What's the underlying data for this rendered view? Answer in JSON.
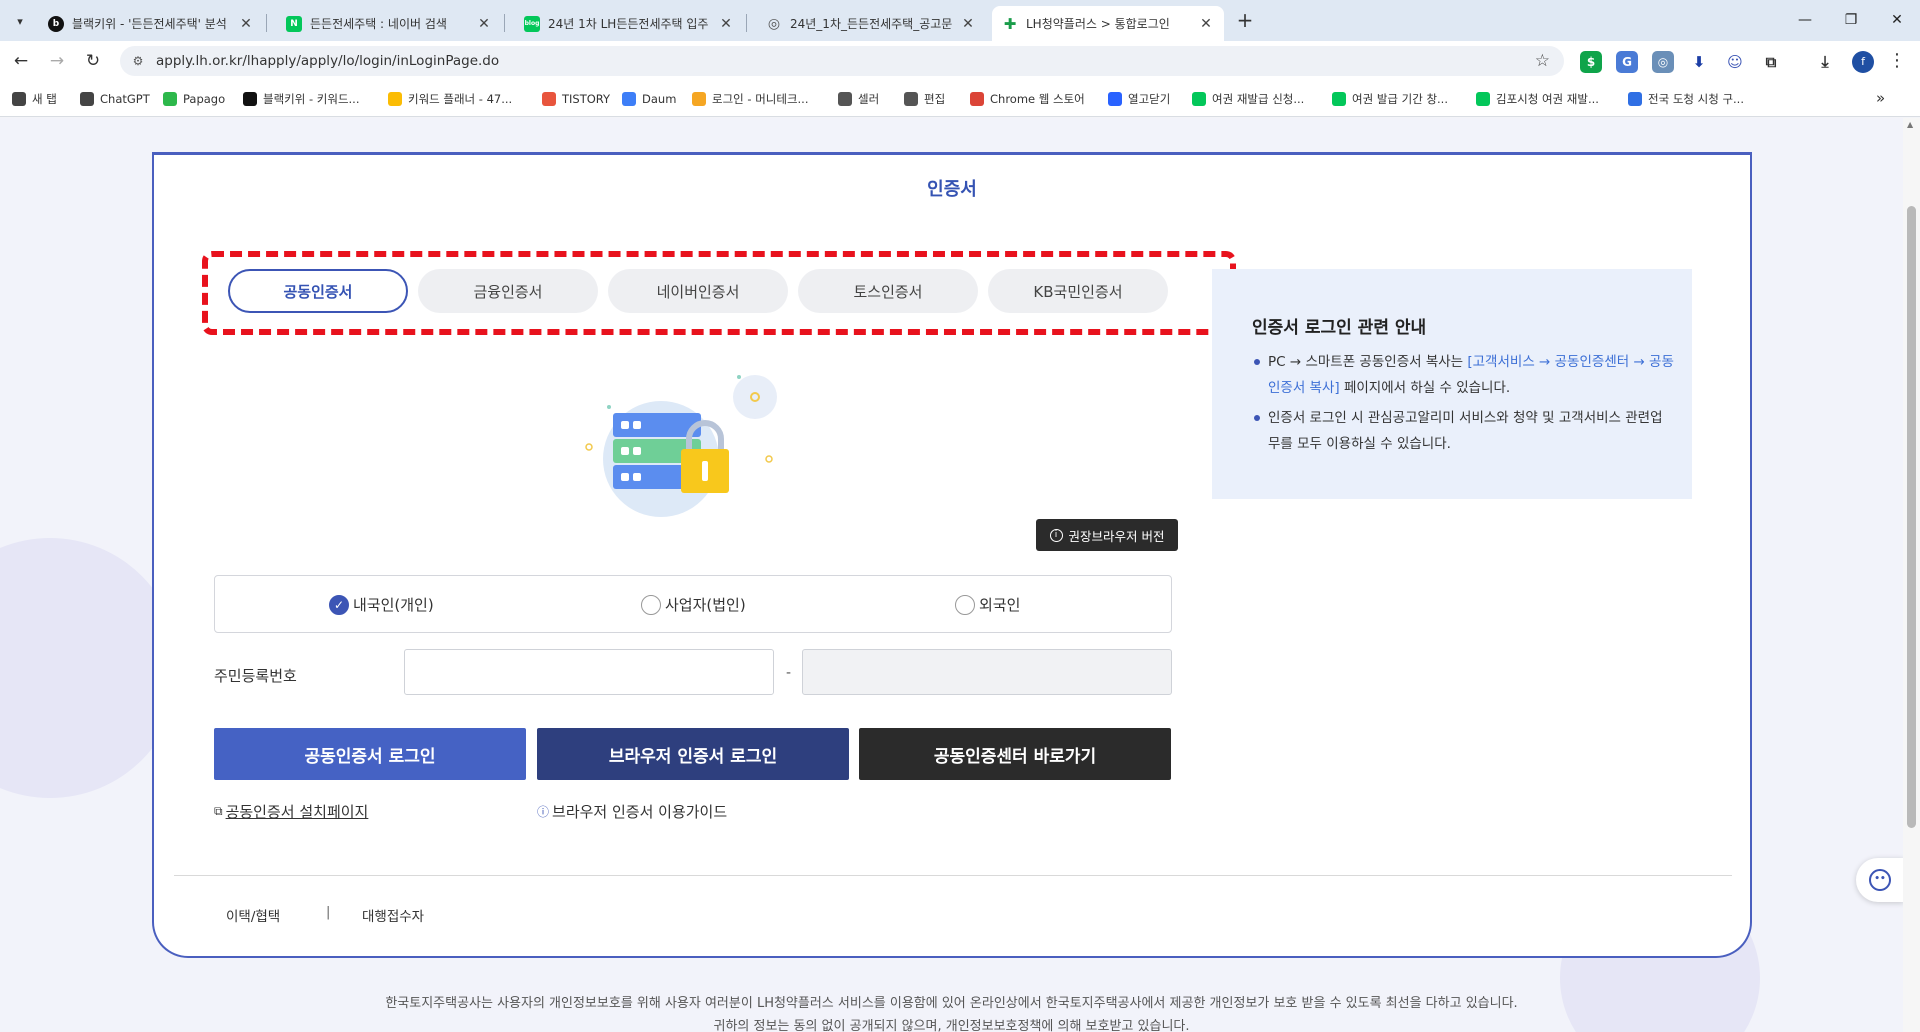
{
  "browser": {
    "tabs": [
      {
        "title": "블랙키위 - '든든전세주택' 분석",
        "fav": "b",
        "fav_color": "#111111"
      },
      {
        "title": "든든전세주택 : 네이버 검색",
        "fav": "N",
        "fav_color": "#03c75a"
      },
      {
        "title": "24년 1차 LH든든전세주택 입주",
        "fav": "blog",
        "fav_color": "#03c75a"
      },
      {
        "title": "24년_1차_든든전세주택_공고문",
        "fav": "◎",
        "fav_color": "#555555"
      },
      {
        "title": "LH청약플러스 > 통합로그인",
        "fav": "✚",
        "fav_color": "#1a9c4a"
      }
    ],
    "url": "apply.lh.or.kr/lhapply/apply/lo/login/inLoginPage.do",
    "bookmarks": [
      {
        "label": "새 탭",
        "icon": "globe-icon",
        "color": "#444444"
      },
      {
        "label": "ChatGPT",
        "icon": "chatgpt-icon",
        "color": "#444444"
      },
      {
        "label": "Papago",
        "icon": "papago-icon",
        "color": "#2db84b"
      },
      {
        "label": "블랙키위 - 키워드...",
        "icon": "blackkiwi-icon",
        "color": "#111111"
      },
      {
        "label": "키워드 플래너 - 47...",
        "icon": "google-ads-icon",
        "color": "#fbbc04"
      },
      {
        "label": "TISTORY",
        "icon": "tistory-icon",
        "color": "#e8553d"
      },
      {
        "label": "Daum",
        "icon": "daum-icon",
        "color": "#3d7ef7"
      },
      {
        "label": "로그인 - 머니테크...",
        "icon": "moneytech-icon",
        "color": "#f5a623"
      },
      {
        "label": "셀러",
        "icon": "folder-icon",
        "color": "#555555"
      },
      {
        "label": "편집",
        "icon": "folder-icon",
        "color": "#555555"
      },
      {
        "label": "Chrome 웹 스토어",
        "icon": "chrome-store-icon",
        "color": "#db4437"
      },
      {
        "label": "열고닫기",
        "icon": "toggle-icon",
        "color": "#2962ff"
      },
      {
        "label": "여권 재발급 신청...",
        "icon": "naver-blog-icon",
        "color": "#03c75a"
      },
      {
        "label": "여권 발급 기간 창...",
        "icon": "naver-blog-icon",
        "color": "#03c75a"
      },
      {
        "label": "김포시청 여권 재발...",
        "icon": "naver-blog-icon",
        "color": "#03c75a"
      },
      {
        "label": "전국 도청 시청 구...",
        "icon": "info-blog-icon",
        "color": "#2f6fe4"
      }
    ],
    "profile_initial": "f"
  },
  "page": {
    "title": "인증서",
    "cert_tabs": [
      "공동인증서",
      "금융인증서",
      "네이버인증서",
      "토스인증서",
      "KB국민인증서"
    ],
    "active_tab": 0,
    "browser_version_btn": "권장브라우저 버전",
    "user_types": [
      {
        "label": "내국인(개인)",
        "checked": true
      },
      {
        "label": "사업자(법인)",
        "checked": false
      },
      {
        "label": "외국인",
        "checked": false
      }
    ],
    "rrn_label": "주민등록번호",
    "rrn_dash": "-",
    "buttons": {
      "cert_login": "공동인증서 로그인",
      "browser_cert_login": "브라우저 인증서 로그인",
      "cert_center": "공동인증센터 바로가기"
    },
    "links": {
      "install": "공동인증서 설치페이지",
      "guide": "브라우저 인증서 이용가이드"
    },
    "footer_links": [
      "이택/협택",
      "대행접수자"
    ],
    "footer_sep": "|",
    "info": {
      "title": "인증서 로그인 관련 안내",
      "item1_pre": "PC → 스마트폰 공동인증서 복사는 ",
      "item1_hl": "[고객서비스 → 공동인증센터 → 공동인증서 복사]",
      "item1_post": " 페이지에서 하실 수 있습니다.",
      "item2": "인증서 로그인 시 관심공고알리미 서비스와 청약 및 고객서비스 관련업무를 모두 이용하실 수 있습니다."
    },
    "privacy_line1": "한국토지주택공사는 사용자의 개인정보보호를 위해 사용자 여러분이 LH청약플러스 서비스를 이용함에 있어 온라인상에서 한국토지주택공사에서 제공한 개인정보가 보호 받을 수 있도록 최선을 다하고 있습니다.",
    "privacy_line2": "귀하의 정보는 동의 없이 공개되지 않으며, 개인정보보호정책에 의해 보호받고 있습니다."
  }
}
